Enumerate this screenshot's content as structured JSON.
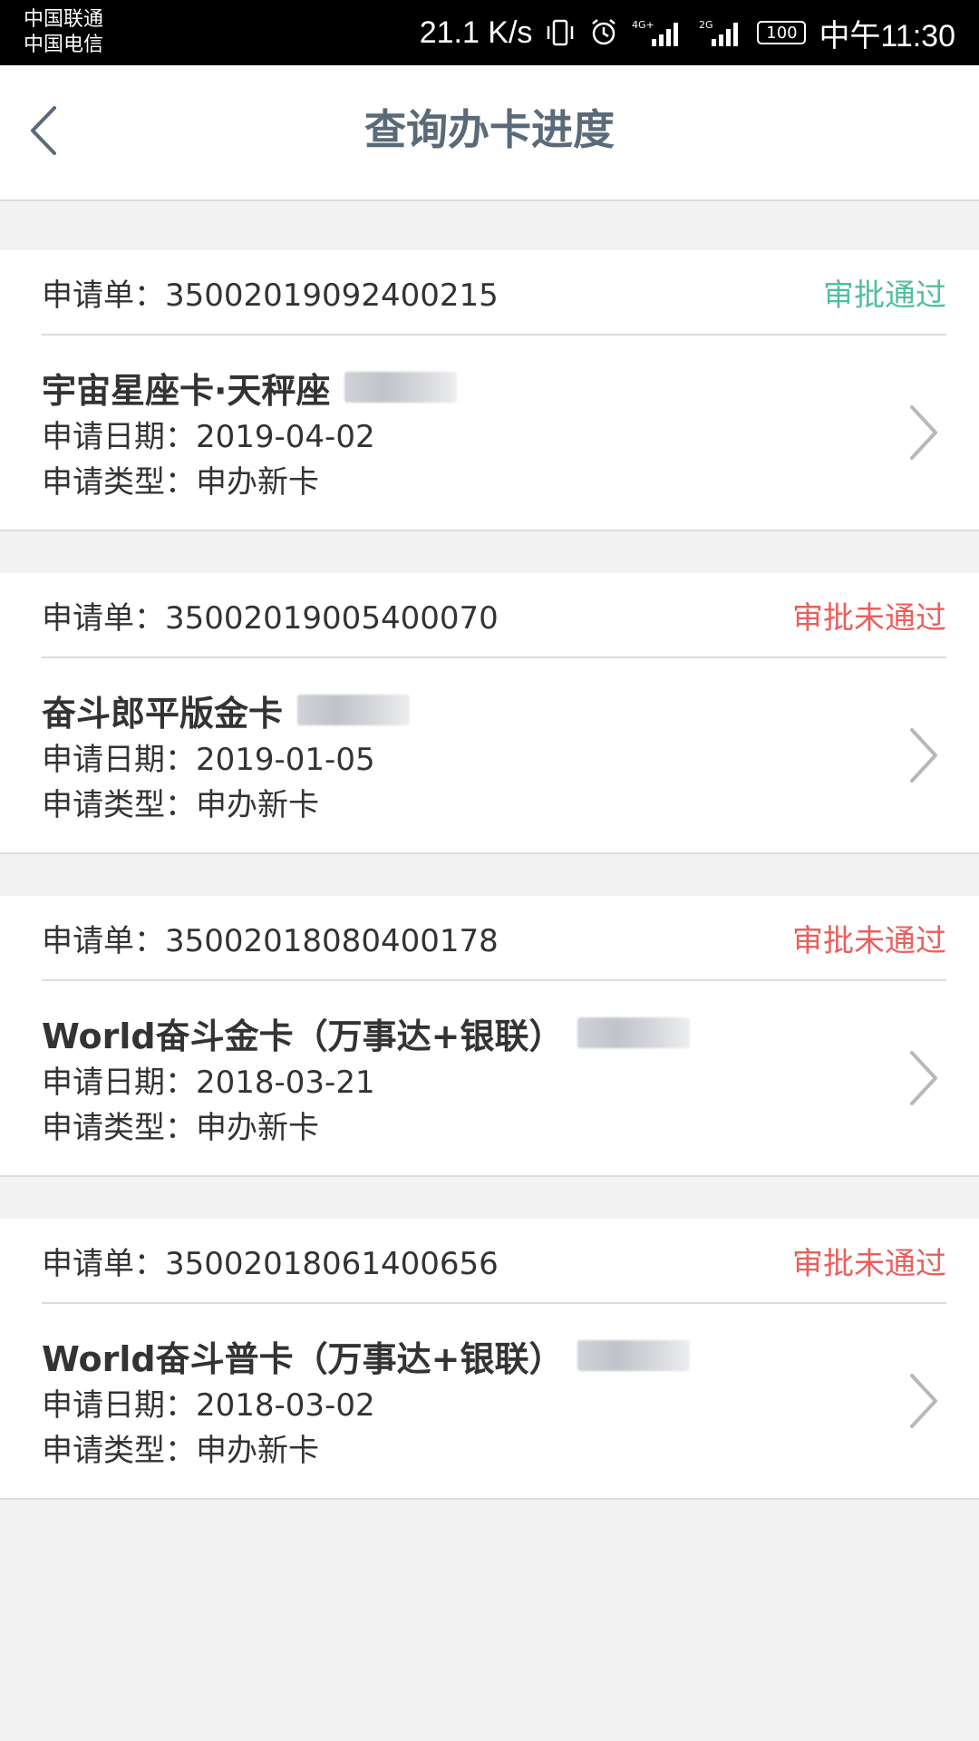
{
  "statusbar": {
    "carrier1": "中国联通",
    "carrier2": "中国电信",
    "speed": "21.1 K/s",
    "battery": "100",
    "time": "中午11:30"
  },
  "nav": {
    "title": "查询办卡进度"
  },
  "labels": {
    "order_prefix": "申请单：",
    "date_prefix": "申请日期：",
    "type_prefix": "申请类型："
  },
  "colors": {
    "approved": "#4fbf9f",
    "rejected": "#e8605d"
  },
  "applications": [
    {
      "order_no": "35002019092400215",
      "status": "审批通过",
      "status_kind": "approved",
      "card_name": "宇宙星座卡·天秤座",
      "date": "2019-04-02",
      "type": "申办新卡"
    },
    {
      "order_no": "35002019005400070",
      "status": "审批未通过",
      "status_kind": "rejected",
      "card_name": "奋斗郎平版金卡",
      "date": "2019-01-05",
      "type": "申办新卡"
    },
    {
      "order_no": "35002018080400178",
      "status": "审批未通过",
      "status_kind": "rejected",
      "card_name": "World奋斗金卡（万事达+银联）",
      "date": "2018-03-21",
      "type": "申办新卡"
    },
    {
      "order_no": "35002018061400656",
      "status": "审批未通过",
      "status_kind": "rejected",
      "card_name": "World奋斗普卡（万事达+银联）",
      "date": "2018-03-02",
      "type": "申办新卡"
    }
  ]
}
